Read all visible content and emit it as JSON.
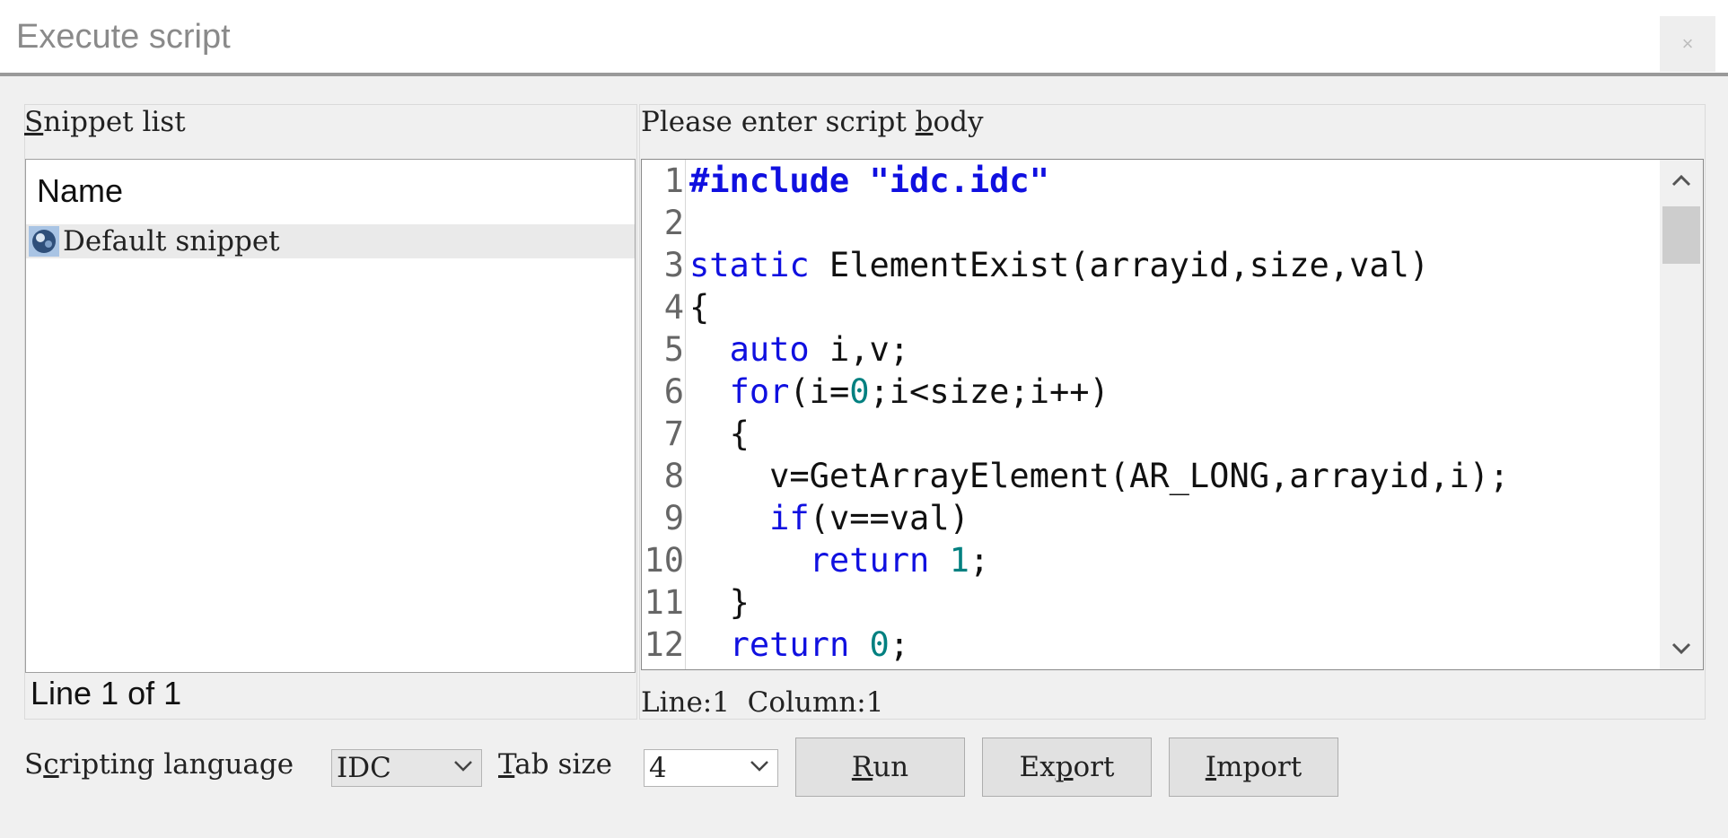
{
  "window": {
    "title": "Execute script",
    "close_label": "×"
  },
  "snippets": {
    "section_label": "Snippet list",
    "column_header": "Name",
    "items": [
      {
        "label": "Default snippet",
        "icon": "snippet-icon"
      }
    ],
    "status": "Line 1 of 1"
  },
  "editor": {
    "section_label": "Please enter script body",
    "lines": [
      {
        "num": "1",
        "indent": 0,
        "tokens": [
          {
            "t": "#include \"idc.idc\"",
            "c": "pp"
          }
        ]
      },
      {
        "num": "2",
        "indent": 0,
        "tokens": []
      },
      {
        "num": "3",
        "indent": 0,
        "tokens": [
          {
            "t": "static",
            "c": "k"
          },
          {
            "t": " ElementExist(arrayid,size,val)",
            "c": ""
          }
        ]
      },
      {
        "num": "4",
        "indent": 0,
        "tokens": [
          {
            "t": "{",
            "c": ""
          }
        ]
      },
      {
        "num": "5",
        "indent": 1,
        "tokens": [
          {
            "t": "auto",
            "c": "k"
          },
          {
            "t": " i,v;",
            "c": ""
          }
        ]
      },
      {
        "num": "6",
        "indent": 1,
        "tokens": [
          {
            "t": "for",
            "c": "k"
          },
          {
            "t": "(i=",
            "c": ""
          },
          {
            "t": "0",
            "c": "n"
          },
          {
            "t": ";i<size;i++)",
            "c": ""
          }
        ]
      },
      {
        "num": "7",
        "indent": 1,
        "tokens": [
          {
            "t": "{",
            "c": ""
          }
        ]
      },
      {
        "num": "8",
        "indent": 2,
        "tokens": [
          {
            "t": "v=GetArrayElement(AR_LONG,arrayid,i);",
            "c": ""
          }
        ]
      },
      {
        "num": "9",
        "indent": 2,
        "tokens": [
          {
            "t": "if",
            "c": "k"
          },
          {
            "t": "(v==val)",
            "c": ""
          }
        ]
      },
      {
        "num": "10",
        "indent": 3,
        "tokens": [
          {
            "t": "return",
            "c": "k"
          },
          {
            "t": " ",
            "c": ""
          },
          {
            "t": "1",
            "c": "n"
          },
          {
            "t": ";",
            "c": ""
          }
        ]
      },
      {
        "num": "11",
        "indent": 1,
        "tokens": [
          {
            "t": "}",
            "c": ""
          }
        ]
      },
      {
        "num": "12",
        "indent": 1,
        "tokens": [
          {
            "t": "return",
            "c": "k"
          },
          {
            "t": " ",
            "c": ""
          },
          {
            "t": "0",
            "c": "n"
          },
          {
            "t": ";",
            "c": ""
          }
        ]
      }
    ],
    "status": "Line:1  Column:1"
  },
  "bottom": {
    "language_label": "Scripting language",
    "language_value": "IDC",
    "tab_label": "Tab size",
    "tab_value": "4",
    "run_label": "Run",
    "export_label": "Export",
    "import_label": "Import"
  }
}
